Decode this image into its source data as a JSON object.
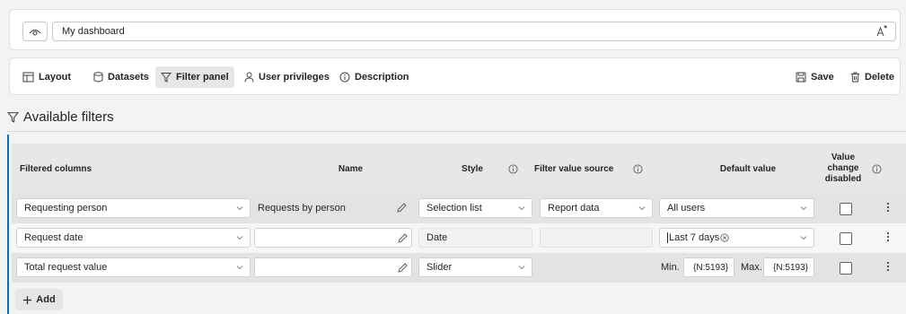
{
  "dashboard": {
    "name": "My dashboard"
  },
  "toolbar": {
    "layout": "Layout",
    "datasets": "Datasets",
    "filter_panel": "Filter panel",
    "user_privileges": "User privileges",
    "description": "Description",
    "save": "Save",
    "delete": "Delete"
  },
  "section": {
    "title": "Available filters"
  },
  "table": {
    "headers": {
      "filtered_columns": "Filtered columns",
      "name": "Name",
      "style": "Style",
      "filter_value_source": "Filter value source",
      "default_value": "Default value",
      "value_change_disabled": "Value change disabled"
    },
    "rows": [
      {
        "column": "Requesting person",
        "name": "Requests by person",
        "style": "Selection list",
        "source": "Report data",
        "default": "All users",
        "disabled": false
      },
      {
        "column": "Request date",
        "name": "",
        "style": "Date",
        "source": "",
        "default": "Last 7 days",
        "disabled": false
      },
      {
        "column": "Total request value",
        "name": "",
        "style": "Slider",
        "source": "",
        "min_label": "Min.",
        "min_value": "{N:5193}",
        "max_label": "Max.",
        "max_value": "{N:5193}",
        "disabled": false
      }
    ]
  },
  "add_button": {
    "label": "Add"
  },
  "colors": {
    "accent": "#0f6cbd",
    "header_bg": "#e7e7e7",
    "row_alt_bg": "#e3e3e3"
  }
}
